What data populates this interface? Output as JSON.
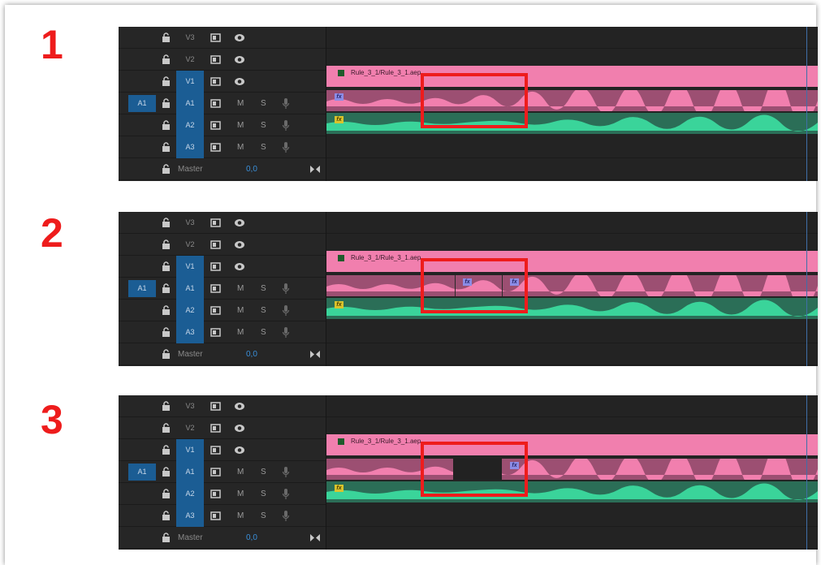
{
  "steps": [
    {
      "number": "1",
      "video_tracks": [
        "V3",
        "V2",
        "V1"
      ],
      "audio_tracks": [
        "A1",
        "A2",
        "A3"
      ],
      "source_patch": "A1",
      "mute_label": "M",
      "solo_label": "S",
      "master_label": "Master",
      "master_value": "0,0",
      "clip_name": "Rule_3_1/Rule_3_1.aep",
      "fx_label": "fx"
    },
    {
      "number": "2",
      "video_tracks": [
        "V3",
        "V2",
        "V1"
      ],
      "audio_tracks": [
        "A1",
        "A2",
        "A3"
      ],
      "source_patch": "A1",
      "mute_label": "M",
      "solo_label": "S",
      "master_label": "Master",
      "master_value": "0,0",
      "clip_name": "Rule_3_1/Rule_3_1.aep",
      "fx_label": "fx"
    },
    {
      "number": "3",
      "video_tracks": [
        "V3",
        "V2",
        "V1"
      ],
      "audio_tracks": [
        "A1",
        "A2",
        "A3"
      ],
      "source_patch": "A1",
      "mute_label": "M",
      "solo_label": "S",
      "master_label": "Master",
      "master_value": "0,0",
      "clip_name": "Rule_3_1/Rule_3_1.aep",
      "fx_label": "fx"
    }
  ],
  "colors": {
    "video_clip": "#f17fae",
    "audio_a1": "#9c4f72",
    "audio_a2": "#2b6e57",
    "highlight": "#ee1c1c",
    "track_target": "#1b5d94"
  },
  "icons": [
    "lock-icon",
    "sync-lock-icon",
    "eye-icon",
    "mic-icon",
    "master-end-icon"
  ]
}
